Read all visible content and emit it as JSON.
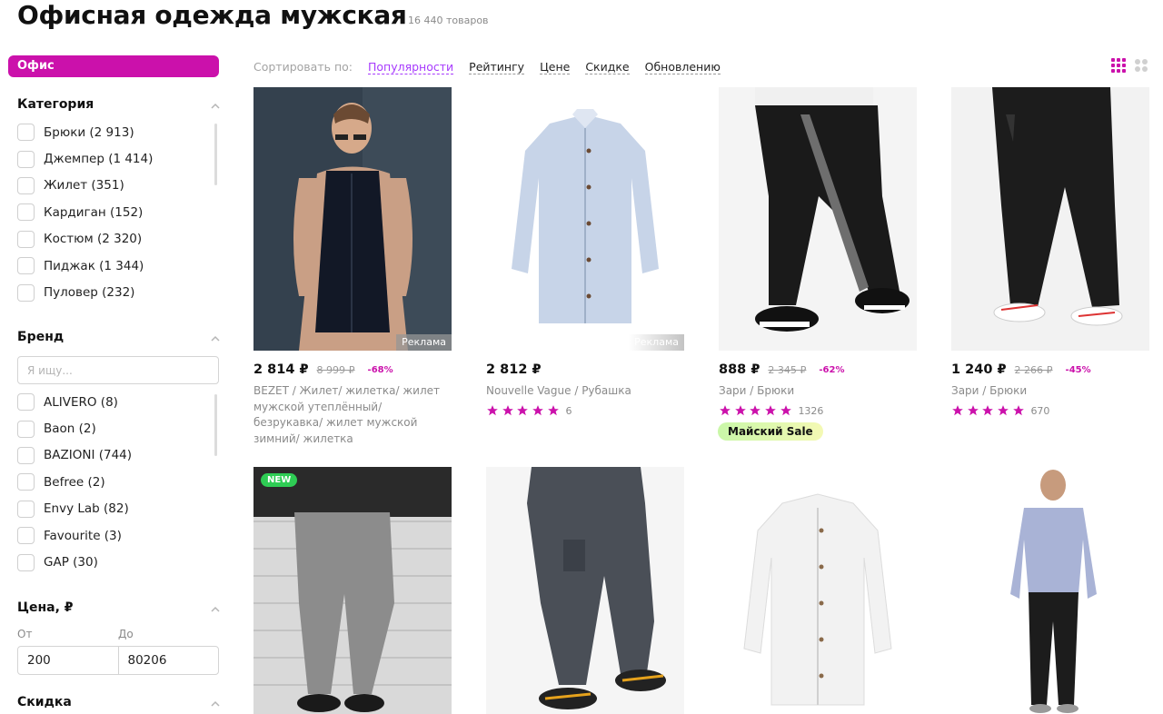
{
  "header": {
    "title": "Офисная одежда мужская",
    "count": "16 440 товаров"
  },
  "sidebar": {
    "chip": "Офис",
    "category": {
      "title": "Категория",
      "items": [
        "Брюки (2 913)",
        "Джемпер (1 414)",
        "Жилет (351)",
        "Кардиган (152)",
        "Костюм (2 320)",
        "Пиджак (1 344)",
        "Пуловер (232)"
      ]
    },
    "brand": {
      "title": "Бренд",
      "search_placeholder": "Я ищу...",
      "items": [
        "ALIVERO (8)",
        "Baon (2)",
        "BAZIONI (744)",
        "Befree (2)",
        "Envy Lab (82)",
        "Favourite (3)",
        "GAP (30)"
      ]
    },
    "price": {
      "title": "Цена, ₽",
      "from_label": "От",
      "to_label": "До",
      "from": "200",
      "to": "80206"
    },
    "discount": {
      "title": "Скидка"
    }
  },
  "sort": {
    "label": "Сортировать по:",
    "options": [
      "Популярности",
      "Рейтингу",
      "Цене",
      "Скидке",
      "Обновлению"
    ],
    "active": "Популярности"
  },
  "view_icons": [
    "grid-large-icon",
    "grid-small-icon"
  ],
  "colors": {
    "accent": "#cb11ab",
    "sort_active": "#a73afd",
    "new_badge": "#2ecc54"
  },
  "products": [
    {
      "price": "2 814 ₽",
      "old_price": "8 999 ₽",
      "discount": "-68%",
      "brand": "BEZET",
      "name": "Жилет/ жилетка/ жилет мужской утеплённый/ безрукавка/ жилет мужской зимний/ жилетка",
      "tag": "Реклама"
    },
    {
      "price": "2 812 ₽",
      "brand": "Nouvelle Vague",
      "name": "Рубашка",
      "rating_count": "6",
      "rating": 5,
      "tag": "Реклама"
    },
    {
      "price": "888 ₽",
      "old_price": "2 345 ₽",
      "discount": "-62%",
      "brand": "Зари",
      "name": "Брюки",
      "rating_count": "1326",
      "rating": 5,
      "badge": "Майский Sale"
    },
    {
      "price": "1 240 ₽",
      "old_price": "2 266 ₽",
      "discount": "-45%",
      "brand": "Зари",
      "name": "Брюки",
      "rating_count": "670",
      "rating": 5
    },
    {
      "badge_new": "NEW"
    },
    {},
    {},
    {}
  ]
}
